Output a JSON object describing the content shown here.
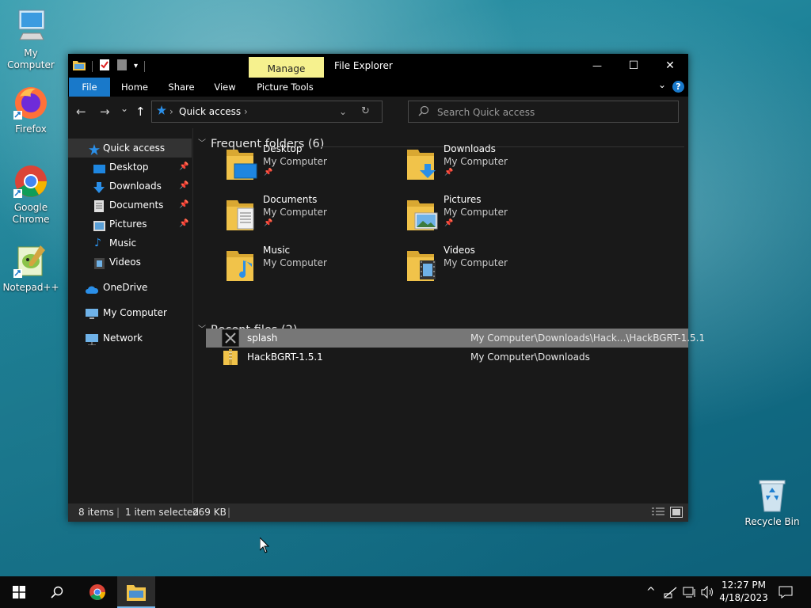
{
  "desktop": {
    "icons": [
      {
        "label": "My Computer"
      },
      {
        "label": "Firefox"
      },
      {
        "label": "Google Chrome"
      },
      {
        "label": "Notepad++"
      },
      {
        "label": "Recycle Bin"
      }
    ]
  },
  "window": {
    "title": "File Explorer",
    "contextual_tab": "Manage",
    "controls": {
      "minimize": "—",
      "maximize": "☐",
      "close": "✕"
    },
    "ribbon_tabs": [
      "File",
      "Home",
      "Share",
      "View",
      "Picture Tools"
    ],
    "help_label": "?",
    "nav": {
      "back": "←",
      "forward": "→",
      "recent": "⌄",
      "up": "↑"
    },
    "address": {
      "path": "Quick access",
      "separator": "›",
      "after": "›"
    },
    "search": {
      "placeholder": "Search Quick access"
    },
    "nav_pane": [
      {
        "label": "Quick access",
        "selected": true,
        "pinned": false
      },
      {
        "label": "Desktop",
        "pinned": true
      },
      {
        "label": "Downloads",
        "pinned": true
      },
      {
        "label": "Documents",
        "pinned": true
      },
      {
        "label": "Pictures",
        "pinned": true
      },
      {
        "label": "Music",
        "pinned": false
      },
      {
        "label": "Videos",
        "pinned": false
      },
      {
        "label": "OneDrive"
      },
      {
        "label": "My Computer"
      },
      {
        "label": "Network"
      }
    ],
    "frequent_header": "Frequent folders (6)",
    "frequent": [
      {
        "name": "Desktop",
        "location": "My Computer",
        "pinned": true
      },
      {
        "name": "Downloads",
        "location": "My Computer",
        "pinned": true
      },
      {
        "name": "Documents",
        "location": "My Computer",
        "pinned": true
      },
      {
        "name": "Pictures",
        "location": "My Computer",
        "pinned": true
      },
      {
        "name": "Music",
        "location": "My Computer",
        "pinned": false
      },
      {
        "name": "Videos",
        "location": "My Computer",
        "pinned": false
      }
    ],
    "recent_header": "Recent files (2)",
    "recent": [
      {
        "name": "splash",
        "path": "My Computer\\Downloads\\Hack...\\HackBGRT-1.5.1",
        "selected": true
      },
      {
        "name": "HackBGRT-1.5.1",
        "path": "My Computer\\Downloads",
        "selected": false
      }
    ],
    "status": {
      "items": "8 items",
      "selected": "1 item selected",
      "size": "269 KB"
    }
  },
  "taskbar": {
    "time": "12:27 PM",
    "date": "4/18/2023",
    "tray_up": "^"
  },
  "colors": {
    "accent": "#1979ca",
    "contextual": "#f6f18e",
    "folder": "#f1c34a"
  }
}
